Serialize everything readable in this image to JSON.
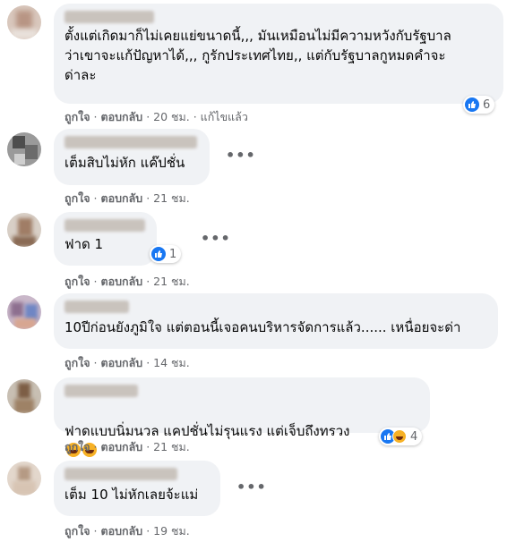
{
  "comments": [
    {
      "text": "ตั้งแต่เกิดมาก็ไม่เคยแย่ขนาดนี้,,, มันเหมือนไม่มีความหวังกับรัฐบาล\nว่าเขาจะแก้ปัญหาได้,,, กูรักประเทศไทย,, แต่กับรัฐบาลกูหมดคำจะ\nด่าละ",
      "like": "ถูกใจ",
      "reply": "ตอบกลับ",
      "time": "20 ชม.",
      "edited": "แก้ไขแล้ว",
      "reaction_count": "6",
      "reactions": [
        "like"
      ]
    },
    {
      "text": "เต็มสิบไม่หัก แค๊ปชั่น",
      "like": "ถูกใจ",
      "reply": "ตอบกลับ",
      "time": "21 ชม."
    },
    {
      "text": "ฟาด 1",
      "like": "ถูกใจ",
      "reply": "ตอบกลับ",
      "time": "21 ชม.",
      "reaction_count": "1",
      "reactions": [
        "like"
      ]
    },
    {
      "text": "10ปีก่อนยังภูมิใจ แต่ตอนนี้เจอคนบริหารจัดการแล้ว...... เหนื่อยจะด่า",
      "like": "ถูกใจ",
      "reply": "ตอบกลับ",
      "time": "14 ชม."
    },
    {
      "text": "ฟาดแบบนิ่มนวล แคปชั่นไม่รุนแรง แต่เจ็บถึงทรวง",
      "like": "ถูกใจ",
      "reply": "ตอบกลับ",
      "time": "21 ชม.",
      "reaction_count": "4",
      "reactions": [
        "like",
        "haha"
      ],
      "emojis": [
        "rolling-laughing",
        "rolling-laughing"
      ]
    },
    {
      "text": "เต็ม 10 ไม่หักเลยจ้ะแม่",
      "like": "ถูกใจ",
      "reply": "ตอบกลับ",
      "time": "19 ชม."
    }
  ],
  "more_icon": "ellipsis-icon",
  "colors": {
    "bubble": "#f0f2f5",
    "meta": "#65676b",
    "like_blue": "#1877f2",
    "haha_yellow": "#f7b125"
  }
}
